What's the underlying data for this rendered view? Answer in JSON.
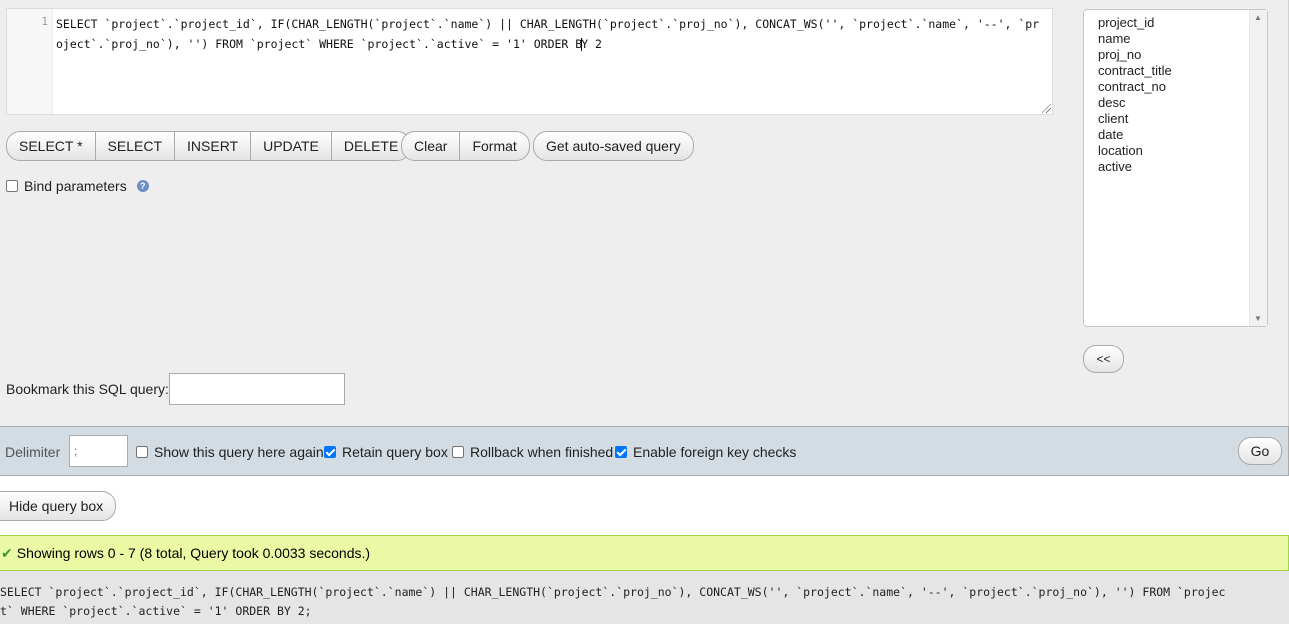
{
  "editor": {
    "line_number": "1",
    "cursor_before": "SELECT `project`.`project_id`, IF(CHAR_LENGTH(`project`.`name`) || CHAR_LENGTH(`project`.`proj_no`), CONCAT_WS('', `project`.`name`, '--', `project`.`proj_no`), '') FROM `project` WHERE `project`.`active` = '1' ORDER B",
    "cursor_after": "Y 2"
  },
  "buttons": {
    "select_star": "SELECT *",
    "select": "SELECT",
    "insert": "INSERT",
    "update": "UPDATE",
    "delete": "DELETE",
    "clear": "Clear",
    "format": "Format",
    "get_autosaved": "Get auto-saved query"
  },
  "bind_parameters": {
    "label": "Bind parameters",
    "checked": false
  },
  "columns": [
    "project_id",
    "name",
    "proj_no",
    "contract_title",
    "contract_no",
    "desc",
    "client",
    "date",
    "location",
    "active"
  ],
  "insert_columns_button": "<<",
  "bookmark": {
    "label": "Bookmark this SQL query:",
    "value": ""
  },
  "options": {
    "delimiter_label": "Delimiter",
    "delimiter_value": ";",
    "show_again": {
      "label": "Show this query here again",
      "checked": false
    },
    "retain_box": {
      "label": "Retain query box",
      "checked": true
    },
    "rollback": {
      "label": "Rollback when finished",
      "checked": false
    },
    "foreign_keys": {
      "label": "Enable foreign key checks",
      "checked": true
    },
    "go": "Go"
  },
  "hide_query_box": "Hide query box",
  "result": {
    "message": "Showing rows 0 - 7 (8 total, Query took 0.0033 seconds.)",
    "sql_text": "SELECT `project`.`project_id`, IF(CHAR_LENGTH(`project`.`name`) || CHAR_LENGTH(`project`.`proj_no`), CONCAT_WS('', `project`.`name`, '--', `project`.`proj_no`), '') FROM `project` WHERE `project`.`active` = '1' ORDER BY 2;"
  },
  "colors": {
    "panel_bg": "#eeeeee",
    "options_bg": "#d3dce3",
    "success_bg": "#ebf8a4",
    "checkbox_checked": "#0075ff",
    "sql_keyword": "#770088",
    "sql_identifier": "#0055aa",
    "sql_string": "#aa1111"
  },
  "icons": {
    "help": "help-icon",
    "success": "check-icon"
  }
}
